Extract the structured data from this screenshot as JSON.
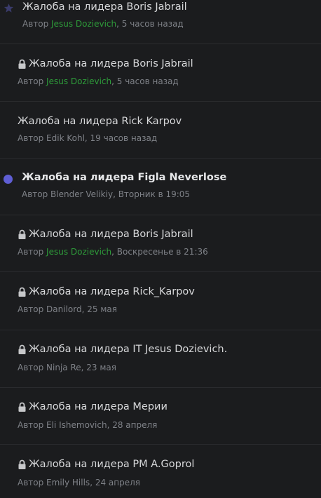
{
  "threads": [
    {
      "title": "Жалоба на лидера Boris Jabrail",
      "prefix": "Автор ",
      "author": "Jesus Dozievich",
      "time": ", 5 часов назад",
      "locked": false
    },
    {
      "title": "Жалоба на лидера Boris Jabrail",
      "prefix": "Автор ",
      "author": "Jesus Dozievich",
      "time": ", 5 часов назад",
      "locked": true
    },
    {
      "title": "Жалоба на лидера Rick Karpov",
      "prefix": "Автор ",
      "author": "Edik Kohl",
      "time": ", 19 часов назад",
      "locked": false
    },
    {
      "title": "Жалоба на лидера Figla Neverlose",
      "prefix": "Автор ",
      "author": "Blender Velikiy",
      "time": ", Вторник в 19:05",
      "locked": false
    },
    {
      "title": "Жалоба на лидера Boris Jabrail",
      "prefix": "Автор ",
      "author": "Jesus Dozievich",
      "time": ", Воскресенье в 21:36",
      "locked": true
    },
    {
      "title": "Жалоба на лидера Rick_Karpov",
      "prefix": "Автор ",
      "author": "Danilord",
      "time": ", 25 мая",
      "locked": true
    },
    {
      "title": "Жалоба на лидера IT Jesus Dozievich.",
      "prefix": "Автор ",
      "author": "Ninja Re",
      "time": ", 23 мая",
      "locked": true
    },
    {
      "title": "Жалоба на лидера Мерии",
      "prefix": "Автор ",
      "author": "Eli Ishemovich",
      "time": ", 28 апреля",
      "locked": true
    },
    {
      "title": "Жалоба на лидера PM A.Goprol",
      "prefix": "Автор ",
      "author": "Emily Hills",
      "time": ", 24 апреля",
      "locked": true
    }
  ],
  "colors": {
    "background": "#1b1c1e",
    "title": "#d7d8da",
    "meta": "#7f8288",
    "author_highlight": "#2e9c3a",
    "unread_dot": "#5f5ed4"
  },
  "icons": {
    "lock": "lock-icon",
    "star": "star-icon",
    "unread": "unread-dot-icon"
  }
}
